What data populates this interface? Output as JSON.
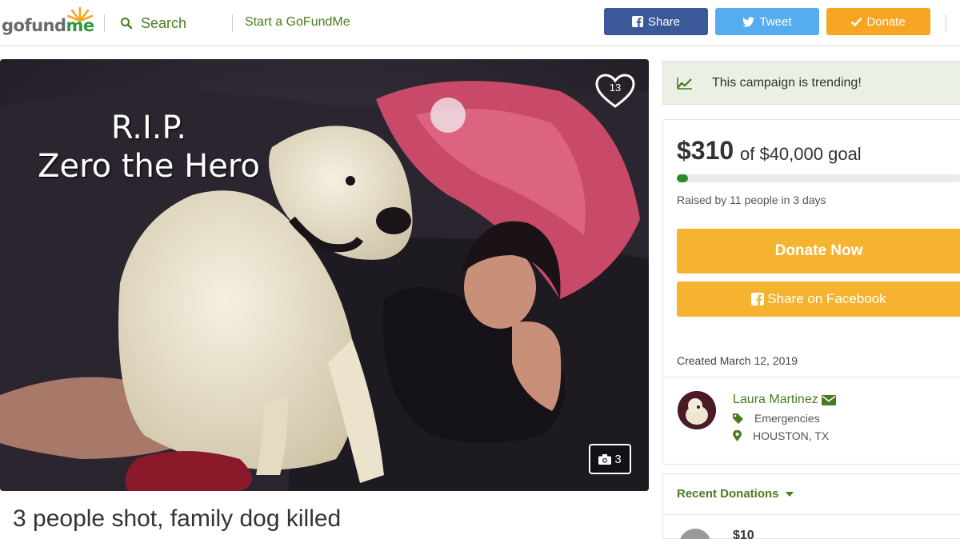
{
  "header": {
    "logo_text_go": "gofund",
    "logo_text_me": "me",
    "search_label": "Search",
    "start_link": "Start a GoFundMe",
    "share_label": "Share",
    "tweet_label": "Tweet",
    "donate_label": "Donate"
  },
  "hero": {
    "overlay_line1": "R.I.P.",
    "overlay_line2": "Zero the Hero",
    "heart_count": "13",
    "photo_count": "3"
  },
  "campaign": {
    "title": "3 people shot, family dog killed"
  },
  "sidebar": {
    "trending_text": "This campaign is trending!",
    "raised_amount": "$310",
    "goal_text": "of $40,000 goal",
    "progress_fraction": 0.00775,
    "raised_by": "Raised by 11 people in 3 days",
    "donate_now": "Donate Now",
    "share_facebook": "Share on Facebook",
    "created": "Created March 12, 2019",
    "organizer_name": "Laura Martinez",
    "category": "Emergencies",
    "location": "HOUSTON, TX",
    "recent_donations": "Recent Donations",
    "recent_amount": "$10"
  },
  "colors": {
    "brand_green": "#2a8a2f",
    "link_green": "#4a7c1f",
    "facebook_blue": "#3b5998",
    "twitter_blue": "#55acee",
    "donate_orange": "#f6a623"
  }
}
